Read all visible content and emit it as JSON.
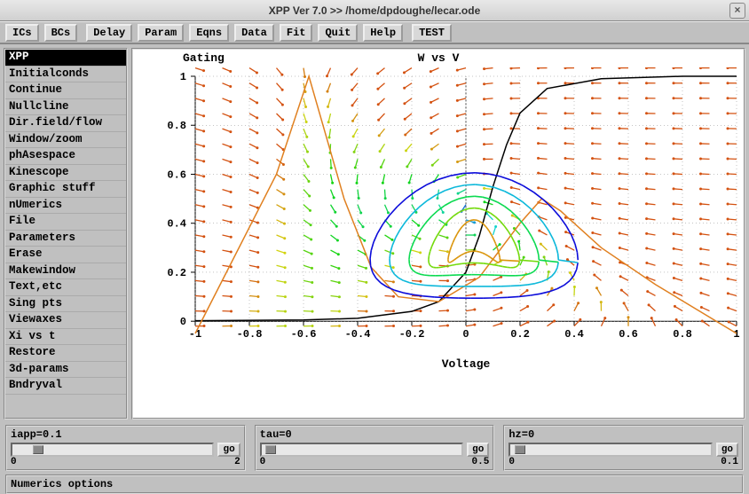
{
  "window": {
    "title": "XPP Ver 7.0 >> /home/dpdoughe/lecar.ode",
    "close": "×"
  },
  "toolbar": {
    "buttons": [
      "ICs",
      "BCs",
      "Delay",
      "Param",
      "Eqns",
      "Data",
      "Fit",
      "Quit",
      "Help",
      "TEST"
    ]
  },
  "sidebar": {
    "selected": 0,
    "items": [
      "XPP",
      "Initialconds",
      "Continue",
      "Nullcline",
      "Dir.field/flow",
      "Window/zoom",
      "phAsespace",
      "Kinescope",
      "Graphic stuff",
      "nUmerics",
      "File",
      "Parameters",
      "Erase",
      "Makewindow",
      "Text,etc",
      "Sing pts",
      "Viewaxes",
      "Xi vs t",
      "Restore",
      "3d-params",
      "Bndryval"
    ]
  },
  "plot": {
    "left_label": "Gating",
    "title": "W vs V",
    "xlabel": "Voltage",
    "xticks": [
      "-1",
      "-0.8",
      "-0.6",
      "-0.4",
      "-0.2",
      "0",
      "0.2",
      "0.4",
      "0.6",
      "0.8",
      "1"
    ],
    "yticks": [
      "0",
      "0.2",
      "0.4",
      "0.6",
      "0.8",
      "1"
    ]
  },
  "panels": [
    {
      "label": "iapp=0.1",
      "min": "0",
      "max": "2",
      "go": "go"
    },
    {
      "label": "tau=0",
      "min": "0",
      "max": "0.5",
      "go": "go"
    },
    {
      "label": "hz=0",
      "min": "0",
      "max": "0.1",
      "go": "go"
    }
  ],
  "status": "Numerics options",
  "chart_data": {
    "type": "phase_plane",
    "title": "W vs V",
    "xlabel": "Voltage",
    "ylabel": "Gating",
    "xlim": [
      -1,
      1
    ],
    "ylim": [
      -0.05,
      1
    ],
    "direction_field": {
      "description": "Vector field arrows on approx 21x18 grid, colored by magnitude/direction (blue-cyan-yellow-orange-red).",
      "grid_spacing_x": 0.1,
      "grid_spacing_y": 0.06
    },
    "nullclines": [
      {
        "name": "w-nullcline (sigmoid)",
        "color": "#000000",
        "points": [
          [
            -1,
            0.002
          ],
          [
            -0.6,
            0.005
          ],
          [
            -0.4,
            0.012
          ],
          [
            -0.2,
            0.04
          ],
          [
            -0.1,
            0.08
          ],
          [
            0,
            0.2
          ],
          [
            0.05,
            0.35
          ],
          [
            0.1,
            0.55
          ],
          [
            0.15,
            0.72
          ],
          [
            0.2,
            0.85
          ],
          [
            0.3,
            0.95
          ],
          [
            0.5,
            0.99
          ],
          [
            0.8,
            1.0
          ],
          [
            1,
            1.0
          ]
        ]
      },
      {
        "name": "V-nullcline",
        "color": "#e08020",
        "points": [
          [
            -1,
            -0.05
          ],
          [
            -0.7,
            0.6
          ],
          [
            -0.58,
            1.0
          ],
          [
            -0.45,
            0.5
          ],
          [
            -0.35,
            0.22
          ],
          [
            -0.25,
            0.1
          ],
          [
            -0.1,
            0.08
          ],
          [
            0.05,
            0.18
          ],
          [
            0.2,
            0.4
          ],
          [
            0.28,
            0.5
          ],
          [
            0.35,
            0.45
          ],
          [
            0.5,
            0.3
          ],
          [
            0.7,
            0.15
          ],
          [
            1,
            -0.05
          ]
        ]
      }
    ],
    "trajectories": [
      {
        "name": "limit-cycle",
        "color_gradient": [
          "#0000ff",
          "#00c0c0",
          "#c0c020",
          "#ff8000"
        ],
        "description": "Closed orbit loops spiraling around a fixed point near (0.05, 0.3), spanning roughly V in [-0.35,0.4] and W in [0.05,0.55]"
      }
    ]
  }
}
